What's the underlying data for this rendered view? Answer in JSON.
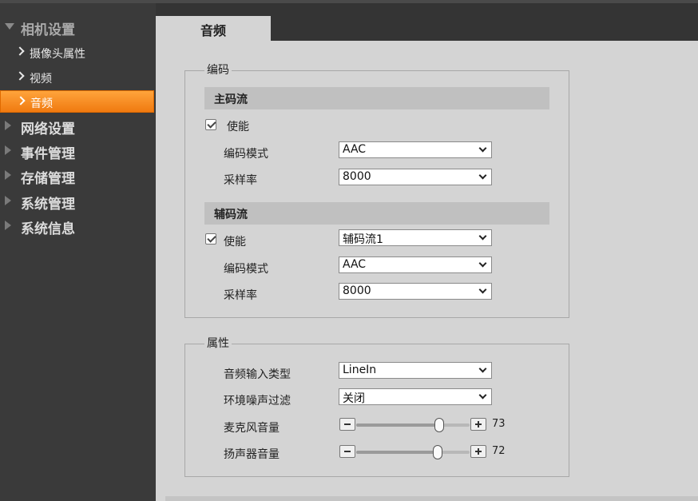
{
  "sidebar": {
    "camera_group": "相机设置",
    "camera_items": [
      {
        "label": "摄像头属性"
      },
      {
        "label": "视频"
      },
      {
        "label": "音频"
      }
    ],
    "groups": [
      {
        "label": "网络设置"
      },
      {
        "label": "事件管理"
      },
      {
        "label": "存储管理"
      },
      {
        "label": "系统管理"
      },
      {
        "label": "系统信息"
      }
    ]
  },
  "tab": {
    "label": "音频"
  },
  "encode": {
    "legend": "编码",
    "main_stream": {
      "title": "主码流",
      "enable_label": "使能",
      "enabled": true,
      "mode_label": "编码模式",
      "mode_value": "AAC",
      "rate_label": "采样率",
      "rate_value": "8000"
    },
    "sub_stream": {
      "title": "辅码流",
      "enable_label": "使能",
      "enabled": true,
      "stream_value": "辅码流1",
      "mode_label": "编码模式",
      "mode_value": "AAC",
      "rate_label": "采样率",
      "rate_value": "8000"
    }
  },
  "props": {
    "legend": "属性",
    "input_type_label": "音频输入类型",
    "input_type_value": "LineIn",
    "noise_filter_label": "环境噪声过滤",
    "noise_filter_value": "关闭",
    "mic_label": "麦克风音量",
    "mic_value": "73",
    "speaker_label": "扬声器音量",
    "speaker_value": "72"
  },
  "colors": {
    "active_menu": "#f58a1e",
    "sidebar_bg": "#3a3a3a",
    "content_bg": "#d4d4d4"
  }
}
